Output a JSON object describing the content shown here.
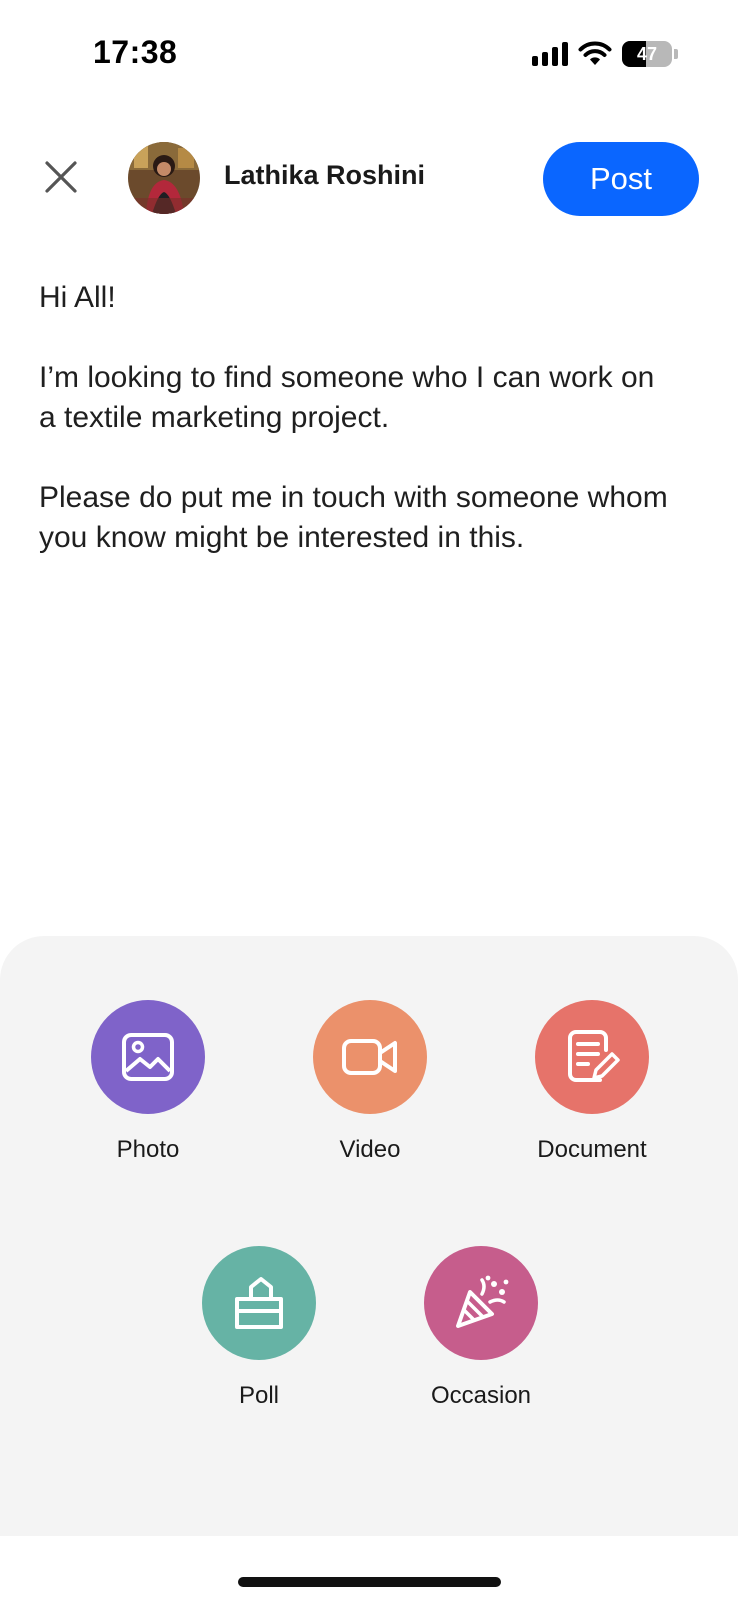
{
  "status_bar": {
    "time": "17:38",
    "battery_level": "47",
    "battery_fraction": 0.47,
    "icons": [
      "cellular-signal-icon",
      "wifi-icon",
      "battery-icon"
    ]
  },
  "header": {
    "close_icon": "close-icon",
    "author_name": "Lathika Roshini",
    "post_label": "Post"
  },
  "compose": {
    "paragraphs": [
      "Hi All!",
      "I’m looking to find someone who I can work on a textile marketing project.",
      "Please do put me in touch with someone whom you know might be interested in this."
    ]
  },
  "attachments": [
    {
      "label": "Photo",
      "icon": "photo-icon",
      "color": "#7f63c9"
    },
    {
      "label": "Video",
      "icon": "video-camera-icon",
      "color": "#eb916b"
    },
    {
      "label": "Document",
      "icon": "document-edit-icon",
      "color": "#e6736a"
    },
    {
      "label": "Poll",
      "icon": "poll-ballot-icon",
      "color": "#66b3a5"
    },
    {
      "label": "Occasion",
      "icon": "party-popper-icon",
      "color": "#c65d8c"
    }
  ],
  "colors": {
    "accent": "#0a66ff",
    "sheet_background": "#f4f4f4"
  }
}
